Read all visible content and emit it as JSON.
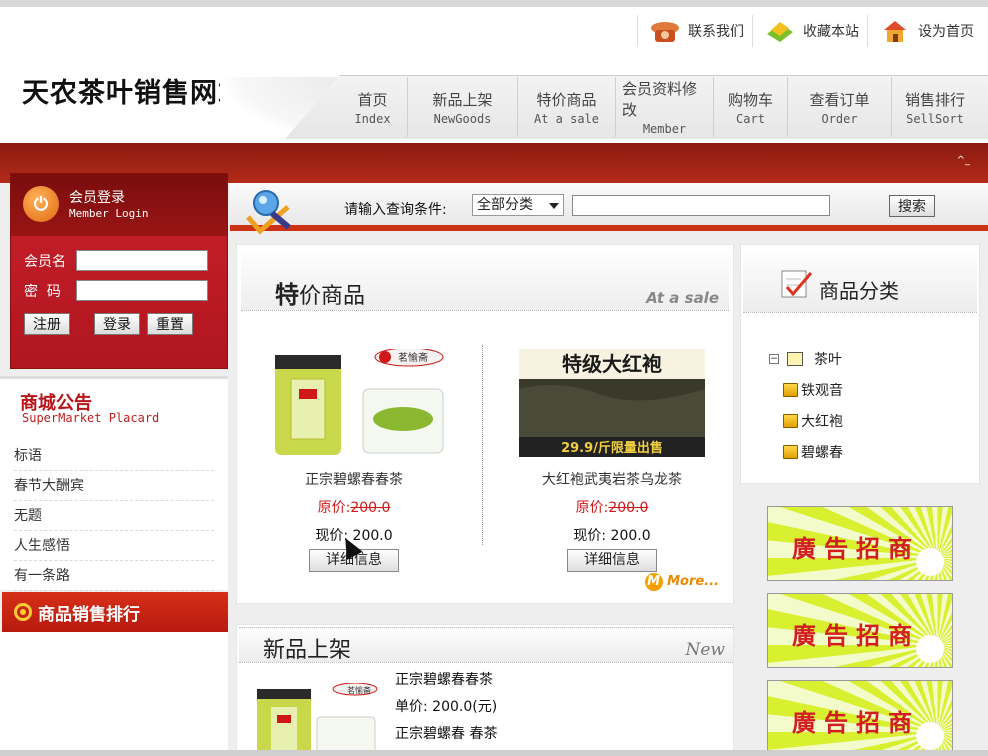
{
  "header": {
    "site_title": "天农茶叶销售网站",
    "top_links": [
      {
        "label": "联系我们",
        "icon": "telephone-icon"
      },
      {
        "label": "收藏本站",
        "icon": "bookmark-icon"
      },
      {
        "label": "设为首页",
        "icon": "home-icon"
      }
    ],
    "nav": [
      {
        "cn": "首页",
        "en": "Index"
      },
      {
        "cn": "新品上架",
        "en": "NewGoods"
      },
      {
        "cn": "特价商品",
        "en": "At a sale"
      },
      {
        "cn": "会员资料修改",
        "en": "Member"
      },
      {
        "cn": "购物车",
        "en": "Cart"
      },
      {
        "cn": "查看订单",
        "en": "Order"
      },
      {
        "cn": "销售排行",
        "en": "SellSort"
      }
    ]
  },
  "login": {
    "title": "会员登录",
    "subtitle": "Member Login",
    "username_label": "会员名",
    "password_label": "密  码",
    "register": "注册",
    "login": "登录",
    "reset": "重置"
  },
  "notice": {
    "title": "商城公告",
    "subtitle": "SuperMarket Placard",
    "items": [
      "标语",
      "春节大酬宾",
      "无题",
      "人生感悟",
      "有一条路"
    ]
  },
  "ranking": {
    "title": "商品销售排行"
  },
  "search": {
    "label": "请输入查询条件:",
    "category": "全部分类",
    "button": "搜索"
  },
  "sale": {
    "title_bold": "特",
    "title_rest": "价商品",
    "title_en": "At a sale",
    "products": [
      {
        "name": "正宗碧螺春春茶",
        "old_price_label": "原价:",
        "old_price": "200.0",
        "now_price": "现价: 200.0",
        "button": "详细信息",
        "image_text": "茗愉斋"
      },
      {
        "name": "大红袍武夷岩茶乌龙茶",
        "old_price_label": "原价:",
        "old_price": "200.0",
        "now_price": "现价: 200.0",
        "button": "详细信息",
        "image_text": "特级大红袍",
        "image_caption": "29.9/斤限量出售"
      }
    ],
    "more": "More..."
  },
  "new_goods": {
    "title": "新品上架",
    "title_en": "New",
    "item": {
      "name": "正宗碧螺春春茶",
      "price": "单价: 200.0(元)",
      "desc": "正宗碧螺春 春茶"
    }
  },
  "category": {
    "title": "商品分类",
    "root": "茶叶",
    "children": [
      "铁观音",
      "大红袍",
      "碧螺春"
    ]
  },
  "ads": [
    "廣告招商",
    "廣告招商",
    "廣告招商"
  ]
}
